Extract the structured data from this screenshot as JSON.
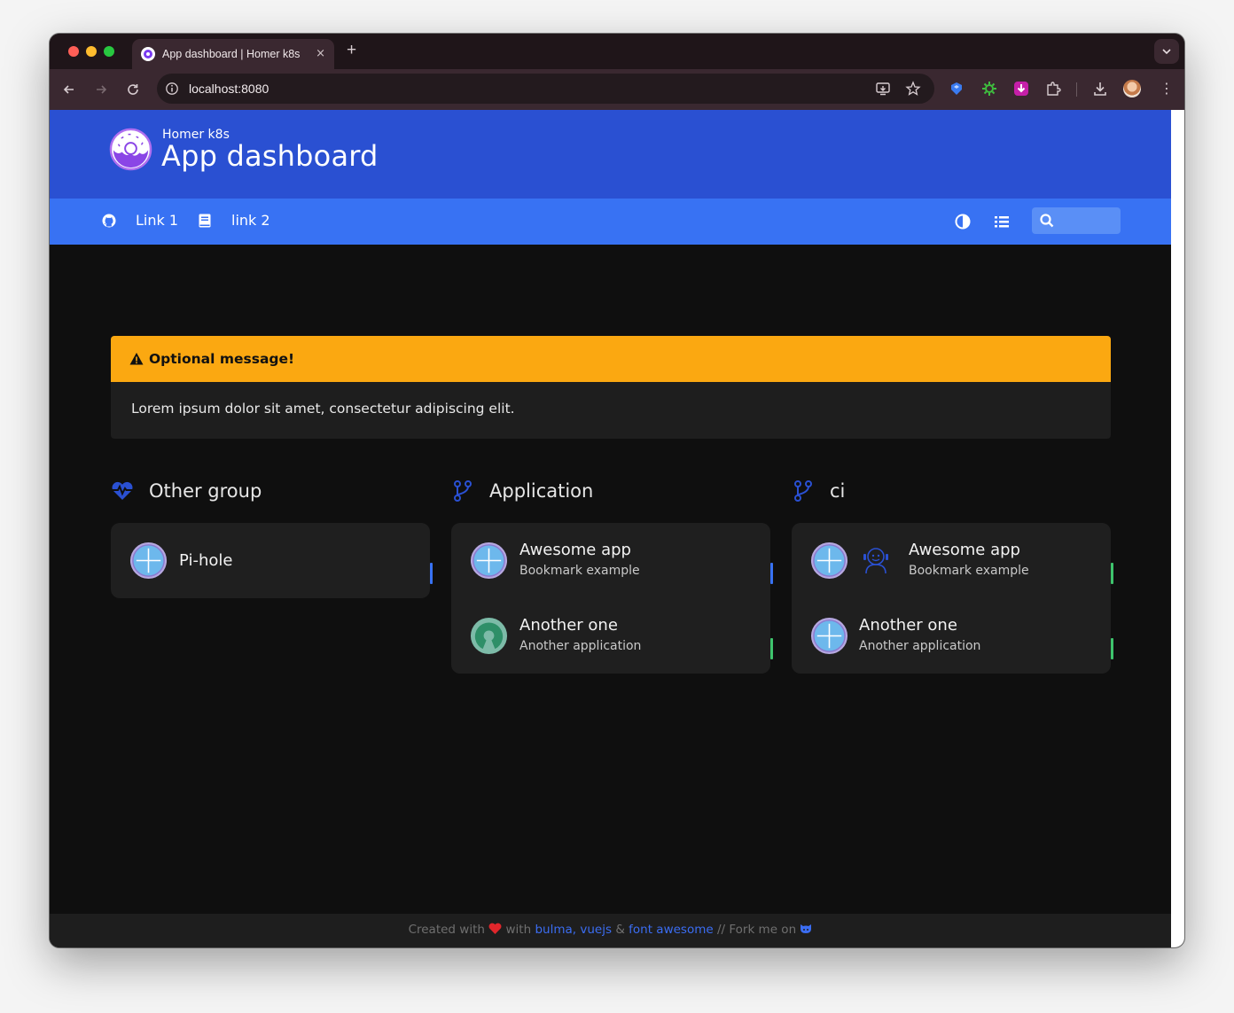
{
  "browser": {
    "tab_title": "App dashboard | Homer k8s",
    "tab_close": "×",
    "new_tab": "+",
    "url": "localhost:8080"
  },
  "header": {
    "headline": "Homer k8s",
    "title": "App dashboard"
  },
  "navbar": {
    "links": [
      {
        "label": "Link 1",
        "icon": "github-icon"
      },
      {
        "label": "link 2",
        "icon": "book-icon"
      }
    ],
    "search_placeholder": ""
  },
  "message": {
    "title": "Optional message!",
    "content": "Lorem ipsum dolor sit amet, consectetur adipiscing elit.",
    "color": "#fba811"
  },
  "groups": [
    {
      "name": "Other group",
      "icon": "heartbeat-icon",
      "items": [
        {
          "name": "Pi-hole",
          "subtitle": "",
          "tag_color": "#3872f3"
        }
      ]
    },
    {
      "name": "Application",
      "icon": "code-branch-icon",
      "items": [
        {
          "name": "Awesome app",
          "subtitle": "Bookmark example",
          "tag_color": "#3872f3"
        },
        {
          "name": "Another one",
          "subtitle": "Another application",
          "tag_color": "#3ec46d"
        }
      ]
    },
    {
      "name": "ci",
      "icon": "code-branch-icon",
      "items": [
        {
          "name": "Awesome app",
          "subtitle": "Bookmark example",
          "tag_color": "#3ec46d"
        },
        {
          "name": "Another one",
          "subtitle": "Another application",
          "tag_color": "#3ec46d"
        }
      ]
    }
  ],
  "footer": {
    "created_with": "Created with",
    "heart": "❤️",
    "with": "with",
    "bulma": "bulma",
    "comma": ",",
    "vuejs": "vuejs",
    "amp": "&",
    "font_awesome": "font awesome",
    "fork": "// Fork me on"
  },
  "colors": {
    "hero": "#2a50d2",
    "navbar": "#3872f3",
    "background": "#0f0f0f",
    "card": "#1f1f1f"
  }
}
